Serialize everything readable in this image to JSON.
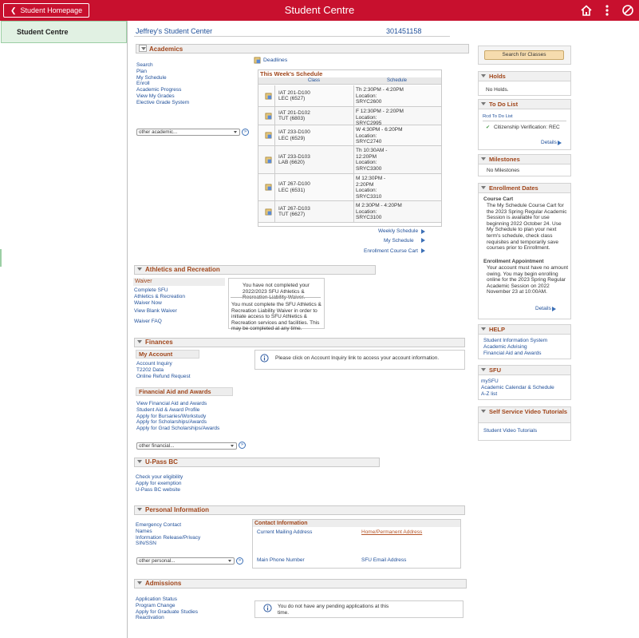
{
  "topbar": {
    "home_label": "Student Homepage",
    "title": "Student Centre"
  },
  "sidebar": {
    "item": "Student Centre"
  },
  "header": {
    "student_center": "Jeffrey's Student Center",
    "student_id": "301451158"
  },
  "academics": {
    "title": "Academics",
    "links": [
      "Search",
      "Plan",
      "My Schedule",
      "Enroll",
      "Academic Progress",
      "View My Grades",
      "Elective Grade System"
    ],
    "select": "other academic...",
    "deadlines": "Deadlines",
    "schedule_title": "This Week's Schedule",
    "col_class": "Class",
    "col_schedule": "Schedule",
    "rows": [
      {
        "c1": "IAT 201-D100",
        "c2": "LEC (6527)",
        "s": [
          "Th 2:30PM - 4:20PM",
          "Location:",
          "SRYC2600"
        ]
      },
      {
        "c1": "IAT 201-D102",
        "c2": "TUT (6803)",
        "s": [
          "F 12:30PM - 2:20PM",
          "Location:",
          "SRYC2995"
        ]
      },
      {
        "c1": "IAT 233-D100",
        "c2": "LEC (6529)",
        "s": [
          "W 4:30PM - 6:20PM",
          "Location:",
          "SRYC2740"
        ]
      },
      {
        "c1": "IAT 233-D103",
        "c2": "LAB (6620)",
        "s": [
          "Th 10:30AM -",
          "12:20PM",
          "Location:",
          "SRYC3300"
        ]
      },
      {
        "c1": "IAT 267-D100",
        "c2": "LEC (6531)",
        "s": [
          "M 12:30PM -",
          "2:20PM",
          "Location:",
          "SRYC3310"
        ]
      },
      {
        "c1": "IAT 267-D103",
        "c2": "TUT (6627)",
        "s": [
          "M 2:30PM - 4:20PM",
          "Location:",
          "SRYC3100"
        ]
      }
    ],
    "weekly": "Weekly Schedule",
    "myschedule": "My Schedule",
    "cart": "Enrollment Course Cart"
  },
  "athletics": {
    "title": "Athletics and Recreation",
    "waiver": "Waiver",
    "links": [
      "Complete SFU",
      "Athletics & Recreation",
      "Waiver Now"
    ],
    "view_blank": "View Blank Waiver",
    "faq": "Waiver FAQ",
    "msg1": "You have not completed your 2022/2023 SFU Athletics & Recreation Liability Waiver.",
    "msg2": "You must complete the SFU Athletics & Recreation Liability Waiver in order to initiate access to SFU Athletics & Recreation services and facilities. This may be completed at any time."
  },
  "finances": {
    "title": "Finances",
    "my_account": "My Account",
    "links": [
      "Account Inquiry",
      "T2202 Data",
      "Online Refund Request"
    ],
    "info": "Please click on Account Inquiry link to access your account information.",
    "aid_title": "Financial Aid and Awards",
    "aid_links": [
      "View Financial Aid and Awards",
      "Student Aid & Award Profile",
      "Apply for Bursaries/Workstudy",
      "Apply for Scholarships/Awards",
      "Apply for Grad Scholarships/Awards"
    ],
    "select": "other financial..."
  },
  "upass": {
    "title": "U-Pass BC",
    "links": [
      "Check your eligibility",
      "Apply for exemption",
      "U-Pass BC website"
    ]
  },
  "personal": {
    "title": "Personal Information",
    "links": [
      "Emergency Contact",
      "Names",
      "Information Release/Privacy",
      "SIN/SSN"
    ],
    "select": "other personal...",
    "contact_title": "Contact Information",
    "mailing": "Current Mailing Address",
    "home": "Home/Permanent Address",
    "phone": "Main Phone Number",
    "email": "SFU Email Address"
  },
  "admissions": {
    "title": "Admissions",
    "links": [
      "Application Status",
      "Program Change",
      "Apply for Graduate Studies",
      "Reactivation"
    ],
    "info": "You do not have any pending applications at this time."
  },
  "right": {
    "search_btn": "Search for Classes",
    "holds": "Holds",
    "holds_text": "No Holds.",
    "todo": "To Do List",
    "todo_col": "Rcd To Do List",
    "todo_item": "Citizenship Verification: REC",
    "details": "Details",
    "milestones": "Milestones",
    "milestones_text": "No Milestones",
    "enroll_dates": "Enrollment Dates",
    "course_cart": "Course Cart",
    "course_cart_text": "The My Schedule Course Cart for the 2023 Spring Regular Academic Session is available for use beginning 2022 October 24. Use My Schedule to plan your next term's schedule, check class requisites and temporarily save courses prior to Enrollment.",
    "enroll_appt": "Enrollment Appointment",
    "enroll_appt_text": "Your account must have no amount owing. You may begin enrolling online for the 2023 Spring Regular Academic Session on 2022 November 23 at 10:00AM.",
    "help": "HELP",
    "help_links": [
      "Student Information System",
      "Academic Advising",
      "Financial Aid and Awards"
    ],
    "sfu": "SFU",
    "sfu_links": [
      "mySFU",
      "Academic Calendar & Schedule",
      "A-Z list"
    ],
    "video": "Self Service Video Tutorials",
    "video_link": "Student Video Tutorials"
  },
  "colors": {
    "brand": "#c8102e",
    "section": "#a0461b",
    "link": "#1f4f99"
  }
}
